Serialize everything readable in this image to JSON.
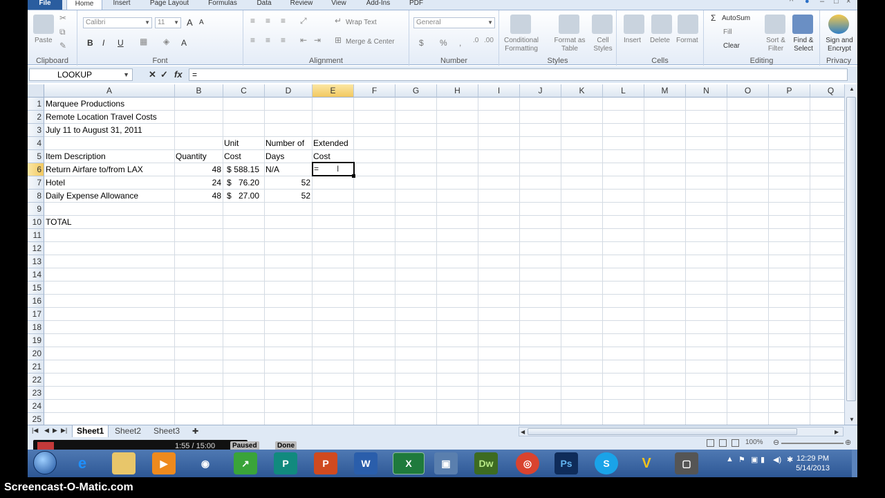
{
  "ribbon": {
    "tabs": [
      "File",
      "Home",
      "Insert",
      "Page Layout",
      "Formulas",
      "Data",
      "Review",
      "View",
      "Add-Ins",
      "PDF"
    ],
    "active_tab": "Home",
    "clipboard": {
      "paste": "Paste",
      "label": "Clipboard"
    },
    "font": {
      "name": "Calibri",
      "size": "11",
      "bold": "B",
      "italic": "I",
      "underline": "U",
      "grow": "A",
      "shrink": "A",
      "color": "A",
      "label": "Font"
    },
    "alignment": {
      "wrap": "Wrap Text",
      "merge": "Merge & Center",
      "label": "Alignment"
    },
    "number": {
      "format": "General",
      "currency": "$",
      "percent": "%",
      "comma": ",",
      "label": "Number"
    },
    "styles": {
      "conditional": "Conditional Formatting",
      "format_table": "Format as Table",
      "cell_styles": "Cell Styles",
      "label": "Styles"
    },
    "cells": {
      "insert": "Insert",
      "delete": "Delete",
      "format": "Format",
      "label": "Cells"
    },
    "editing": {
      "autosum": "AutoSum",
      "fill": "Fill",
      "clear": "Clear",
      "sort": "Sort & Filter",
      "find": "Find & Select",
      "label": "Editing"
    },
    "privacy": {
      "sign": "Sign and Encrypt",
      "label": "Privacy"
    }
  },
  "formula_bar": {
    "name_box": "LOOKUP",
    "fx": "fx",
    "formula": "="
  },
  "columns": [
    "A",
    "B",
    "C",
    "D",
    "E",
    "F",
    "G",
    "H",
    "I",
    "J",
    "K",
    "L",
    "M",
    "N",
    "O",
    "P",
    "Q"
  ],
  "selected_column": "E",
  "rows": [
    "1",
    "2",
    "3",
    "4",
    "5",
    "6",
    "7",
    "8",
    "9",
    "10",
    "11",
    "12",
    "13",
    "14",
    "15",
    "16",
    "17",
    "18",
    "19",
    "20",
    "21",
    "22",
    "23",
    "24",
    "25"
  ],
  "selected_row": "6",
  "cells": {
    "A1": "Marquee Productions",
    "A2": "Remote Location Travel Costs",
    "A3": "July 11 to August 31, 2011",
    "C4": "Unit",
    "D4": "Number of",
    "E4": "Extended",
    "A5": "Item Description",
    "B5": "Quantity",
    "C5": "Cost",
    "D5": "Days",
    "E5": "Cost",
    "A6": "Return Airfare to/from LAX",
    "B6": "48",
    "C6_sym": "$",
    "C6": "588.15",
    "D6": "N/A",
    "E6": "=",
    "A7": "Hotel",
    "B7": "24",
    "C7_sym": "$",
    "C7": "76.20",
    "D7": "52",
    "A8": "Daily Expense Allowance",
    "B8": "48",
    "C8_sym": "$",
    "C8": "27.00",
    "D8": "52",
    "A10": "TOTAL"
  },
  "sheets": [
    "Sheet1",
    "Sheet2",
    "Sheet3"
  ],
  "active_sheet": "Sheet1",
  "status": {
    "zoom": "100%"
  },
  "recorder": {
    "time": "1:55 / 15:00",
    "pause": "Paused",
    "done": "Done"
  },
  "taskbar": {
    "apps": [
      "Internet Explorer",
      "Windows Explorer",
      "Media Player",
      "Network",
      "Stocks",
      "Publisher",
      "PowerPoint",
      "Word",
      "Excel",
      "Remote Desktop",
      "Dreamweaver",
      "Chrome",
      "Photoshop",
      "Skype",
      "Vectorizer",
      "Snipping Tool"
    ],
    "time": "12:29 PM",
    "date": "5/14/2013"
  },
  "watermark": "Screencast-O-Matic.com",
  "colors": {
    "ribbon_blue": "#2a5d9f",
    "selected_header": "#f2c860",
    "excel_green": "#1f7a3c"
  }
}
